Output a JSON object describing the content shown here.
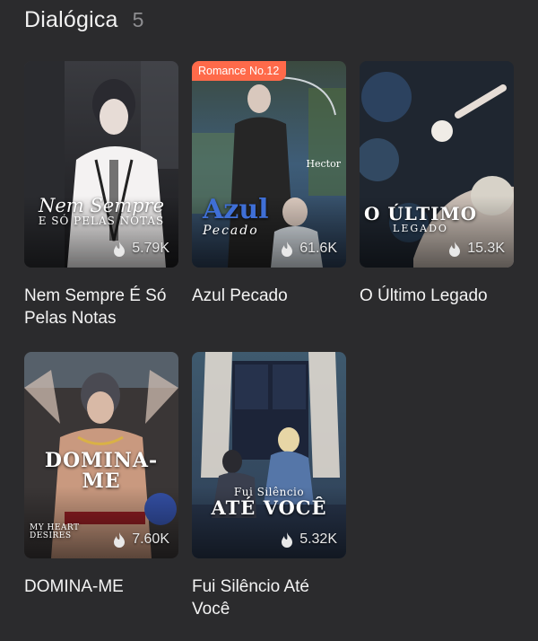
{
  "section": {
    "title": "Dialógica",
    "count": "5"
  },
  "books": [
    {
      "title": "Nem Sempre É Só Pelas Notas",
      "cover_title_line1": "Nem Sempre",
      "cover_title_line2": "E SÓ PELAS NOTAS",
      "reads": "5.79K",
      "icon": "fire-icon"
    },
    {
      "title": "Azul Pecado",
      "badge": "Romance No.12",
      "cover_title_line1": "Azul",
      "cover_title_line2": "Pecado",
      "cover_author": "Hector",
      "reads": "61.6K",
      "icon": "fire-icon"
    },
    {
      "title": "O Último Legado",
      "cover_title_line1": "O ÚLTIMO",
      "cover_title_line2": "LEGADO",
      "reads": "15.3K",
      "icon": "fire-icon"
    },
    {
      "title": "DOMINA-ME",
      "cover_title_line1": "DOMINA-ME",
      "cover_title_line2": "MY HEART DESIRES",
      "reads": "7.60K",
      "icon": "fire-icon"
    },
    {
      "title": "Fui Silêncio Até Você",
      "cover_title_line1": "Fui Silêncio",
      "cover_title_line2": "ATÉ VOCÊ",
      "reads": "5.32K",
      "icon": "fire-icon"
    }
  ],
  "colors": {
    "background": "#2b2b2d",
    "badge": "#ff6a4a",
    "muted": "#8d8d90"
  }
}
